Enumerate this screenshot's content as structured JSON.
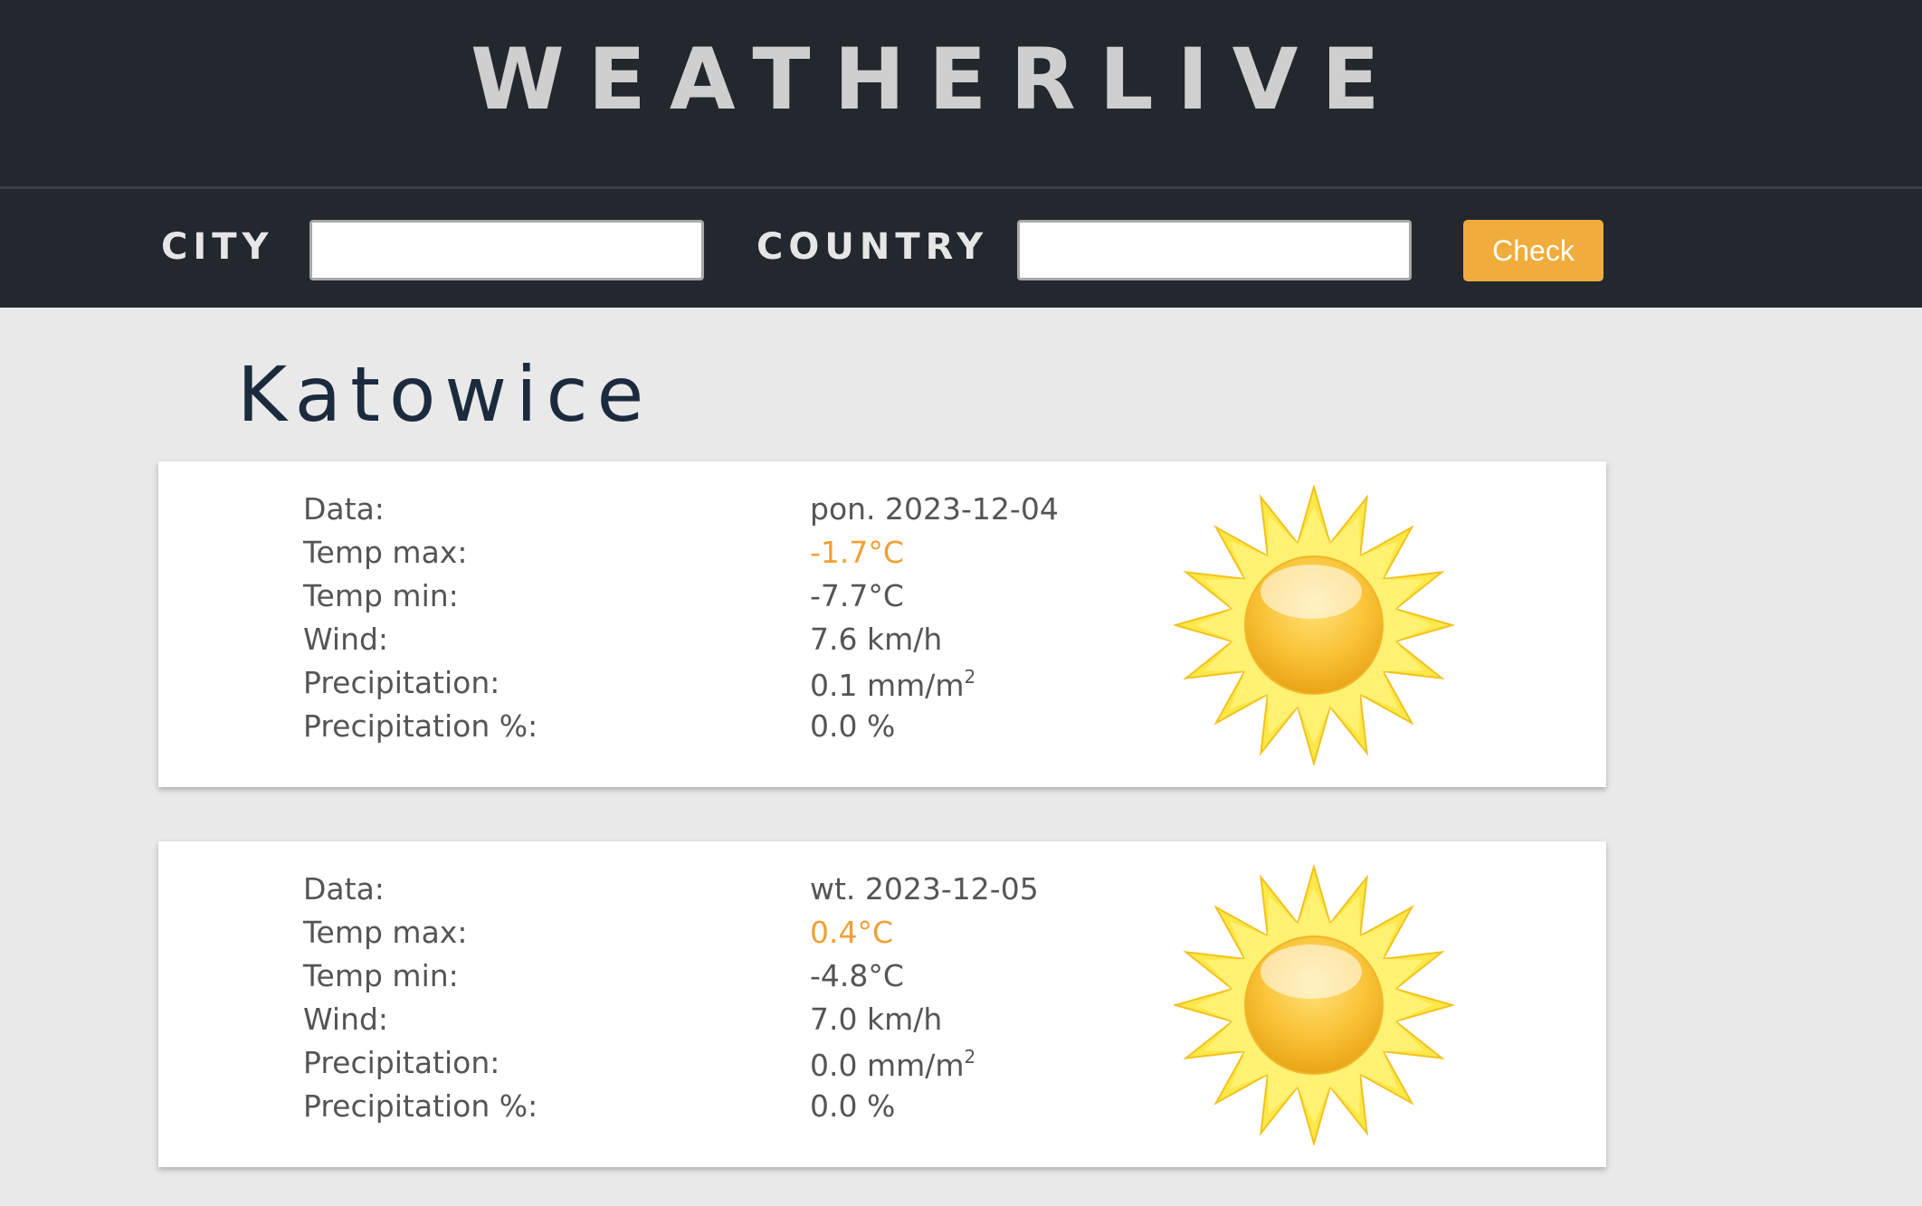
{
  "app": {
    "title": "WEATHERLIVE"
  },
  "search": {
    "city_label": "CITY",
    "city_value": "",
    "city_placeholder": "",
    "country_label": "COUNTRY",
    "country_value": "",
    "country_placeholder": "",
    "check_label": "Check"
  },
  "location": {
    "city": "Katowice"
  },
  "labels": {
    "date": "Data:",
    "temp_max": "Temp max:",
    "temp_min": "Temp min:",
    "wind": "Wind:",
    "precipitation": "Precipitation:",
    "precipitation_pct": "Precipitation %:"
  },
  "forecast": [
    {
      "date": "pon. 2023-12-04",
      "temp_max": "-1.7°C",
      "temp_min": "-7.7°C",
      "wind": "7.6 km/h",
      "precipitation": "0.1 mm/m",
      "precipitation_unit_exp": "2",
      "precipitation_pct": "0.0 %",
      "icon": "sun-icon"
    },
    {
      "date": "wt. 2023-12-05",
      "temp_max": "0.4°C",
      "temp_min": "-4.8°C",
      "wind": "7.0 km/h",
      "precipitation": "0.0 mm/m",
      "precipitation_unit_exp": "2",
      "precipitation_pct": "0.0 %",
      "icon": "sun-icon"
    }
  ],
  "colors": {
    "header_bg": "#23272e",
    "accent": "#f0ad3c",
    "temp_max": "#f0a035",
    "page_bg": "#e9e9e9"
  }
}
